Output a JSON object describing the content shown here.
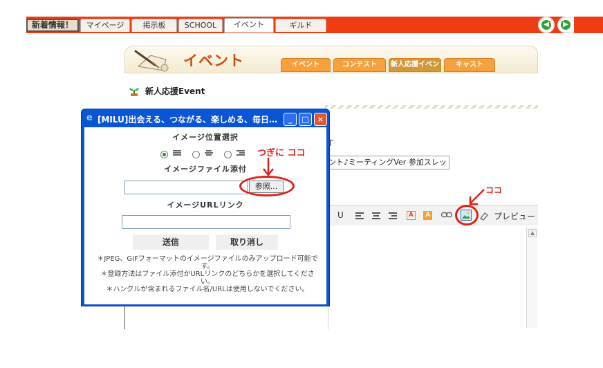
{
  "nav": {
    "tabs": [
      "新着情報！",
      "マイページ",
      "掲示板",
      "SCHOOL",
      "イベント",
      "ギルド"
    ],
    "active_tab": "イベント",
    "back_icon": "back-arrow-icon",
    "forward_icon": "forward-arrow-icon"
  },
  "event_header": {
    "title": "イベント",
    "subtabs": [
      "イベント",
      "コンテスト",
      "新人応援イベント",
      "キャスト"
    ]
  },
  "section": {
    "title": "新人応援Event"
  },
  "background_form": {
    "partial_text": "T",
    "subject_value": "ント♪ミーティングVer 参加スレッ",
    "toolbar": {
      "underline": "U",
      "preview_label": "プレビュー"
    }
  },
  "dialog": {
    "title": "[MILU]出会える、つながる、楽しめる、毎日…",
    "image_position_label": "イメージ位置選択",
    "image_file_label": "イメージファイル添付",
    "browse_label": "参照...",
    "image_url_label": "イメージURLリンク",
    "file_value": "",
    "url_value": "",
    "submit_label": "送信",
    "cancel_label": "取り消し",
    "notes": [
      "＊JPEG、GIFフォーマットのイメージファイルのみアップロード可能です。",
      "＊登録方法はファイル添付かURLリンクのどちらかを選択してください。",
      "＊ハングルが含まれるファイル名/URLは使用しないでください。"
    ]
  },
  "annotations": {
    "next_here": "つぎに ココ",
    "here": "ココ",
    "color": "#e0201a"
  }
}
